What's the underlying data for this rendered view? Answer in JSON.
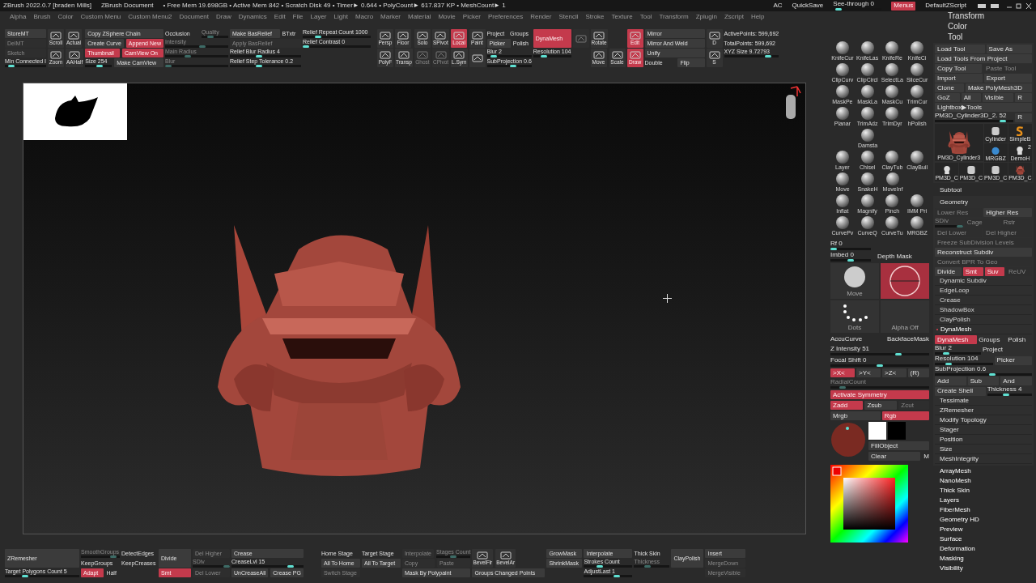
{
  "title_bar": {
    "title": "ZBrush 2022.0.7 [braden Mills]",
    "document": "ZBrush Document",
    "stats": "• Free Mem 19.698GB • Active Mem 842 • Scratch Disk 49 • Timer► 0.644 • PolyCount► 617.837 KP • MeshCount► 1",
    "right": [
      {
        "kind": "text",
        "label": "AC"
      },
      {
        "kind": "text",
        "label": "QuickSave"
      },
      {
        "kind": "slider",
        "label": "See-through  0",
        "level": 0.05,
        "disabled": false
      },
      {
        "kind": "btn",
        "label": "Menus",
        "on": true,
        "disabled": false
      },
      {
        "kind": "text",
        "label": "DefaultZScript"
      }
    ]
  },
  "menu_bar": [
    "Alpha",
    "Brush",
    "Color",
    "Custom Menu",
    "Custom Menu2",
    "Document",
    "Draw",
    "Dynamics",
    "Edit",
    "File",
    "Layer",
    "Light",
    "Macro",
    "Marker",
    "Material",
    "Movie",
    "Picker",
    "Preferences",
    "Render",
    "Stencil",
    "Stroke",
    "Texture",
    "Tool",
    "Transform",
    "Zplugin",
    "Zscript",
    "Help"
  ],
  "top_shelf": [
    [
      [
        {
          "kind": "btn",
          "label": "StoreMT",
          "on": false,
          "disabled": false
        }
      ],
      [
        {
          "kind": "btn",
          "label": "DelMT",
          "on": false,
          "disabled": true
        }
      ],
      [
        {
          "kind": "btn",
          "label": "Sketch",
          "on": false,
          "disabled": true
        }
      ],
      [
        {
          "kind": "slider",
          "label": "Min Connected I",
          "level": 0.1,
          "disabled": false
        }
      ]
    ],
    [
      [
        {
          "kind": "tile",
          "label": "Scroll",
          "on": false,
          "disabled": false
        }
      ],
      [
        {
          "kind": "tile",
          "label": "Zoom",
          "on": false,
          "disabled": false
        }
      ]
    ],
    [
      [
        {
          "kind": "tile",
          "label": "Actual",
          "on": false,
          "disabled": false
        }
      ],
      [
        {
          "kind": "tile",
          "label": "AAHalf",
          "on": false,
          "disabled": false
        }
      ]
    ],
    [
      [
        {
          "kind": "btn",
          "label": "Copy ZSphere Chain",
          "on": false,
          "disabled": false
        }
      ],
      [
        {
          "kind": "btn",
          "label": "Create Curve",
          "on": false,
          "disabled": false
        },
        {
          "kind": "btn",
          "label": "Append New",
          "on": true,
          "disabled": false
        }
      ],
      [
        {
          "kind": "btn",
          "label": "Thumbnail",
          "on": true,
          "disabled": false
        },
        {
          "kind": "btn",
          "label": "CamView On",
          "on": true,
          "disabled": false
        }
      ],
      [
        {
          "kind": "slider",
          "label": "Size 254",
          "level": 0.55,
          "disabled": false
        },
        {
          "kind": "btn",
          "label": "Make CamView",
          "on": false,
          "disabled": false
        }
      ]
    ],
    [
      [
        {
          "kind": "text",
          "label": "Occlusion"
        },
        {
          "kind": "slider",
          "label": "Quality",
          "level": 0.3,
          "disabled": true
        }
      ],
      [
        {
          "kind": "slider",
          "label": "Intensity",
          "level": 0.6,
          "disabled": true
        }
      ],
      [
        {
          "kind": "slider",
          "label": "Main Radius",
          "level": 0.35,
          "disabled": true
        }
      ],
      [
        {
          "kind": "slider",
          "label": "Blur",
          "level": 0.0,
          "disabled": true
        }
      ]
    ],
    [
      [
        {
          "kind": "btn",
          "label": "Make BasRelief",
          "on": false,
          "disabled": false
        },
        {
          "kind": "text",
          "label": "BTxtr"
        }
      ],
      [
        {
          "kind": "btn",
          "label": "Apply BasRelief",
          "on": false,
          "disabled": true
        }
      ],
      [
        {
          "kind": "slider",
          "label": "Relief Blur Radius 4",
          "level": 0.4,
          "disabled": false
        }
      ],
      [
        {
          "kind": "slider",
          "label": "Relief Step Tolerance 0.2",
          "level": 0.4,
          "disabled": false
        }
      ]
    ],
    [
      [
        {
          "kind": "slider",
          "label": "Relief Repeat Count 1000",
          "level": 0.2,
          "disabled": false
        }
      ],
      [
        {
          "kind": "slider",
          "label": "Relief Contrast 0",
          "level": 0.0,
          "disabled": false
        }
      ]
    ],
    [
      [
        {
          "kind": "tile",
          "label": "Persp",
          "on": false,
          "disabled": false
        }
      ],
      [
        {
          "kind": "tile",
          "label": "PolyF",
          "on": false,
          "disabled": false
        }
      ]
    ],
    [
      [
        {
          "kind": "tile",
          "label": "Floor",
          "on": false,
          "disabled": false
        }
      ],
      [
        {
          "kind": "tile",
          "label": "Transp",
          "on": false,
          "disabled": false
        }
      ]
    ],
    [
      [
        {
          "kind": "tile",
          "label": "Solo",
          "on": false,
          "disabled": false
        }
      ],
      [
        {
          "kind": "tile",
          "label": "Ghost",
          "on": false,
          "disabled": true
        }
      ]
    ],
    [
      [
        {
          "kind": "tile",
          "label": "SPivot",
          "on": false,
          "disabled": false
        }
      ],
      [
        {
          "kind": "tile",
          "label": "CPivot",
          "on": false,
          "disabled": true
        }
      ]
    ],
    [
      [
        {
          "kind": "tile",
          "label": "Local",
          "on": true,
          "disabled": false
        }
      ],
      [
        {
          "kind": "tile",
          "label": "L.Sym",
          "on": false,
          "disabled": false
        }
      ]
    ],
    [
      [
        {
          "kind": "tile",
          "label": "Paint",
          "on": false,
          "disabled": false
        }
      ],
      [
        {
          "kind": "tile",
          "on": false,
          "disabled": false
        }
      ]
    ],
    [
      [
        {
          "kind": "text",
          "label": "Project"
        },
        {
          "kind": "text",
          "label": "Groups"
        }
      ],
      [
        {
          "kind": "btn",
          "label": "Picker",
          "on": false,
          "disabled": false
        },
        {
          "kind": "text",
          "label": "Polish"
        }
      ],
      [
        {
          "kind": "slider",
          "label": "Blur 2",
          "level": 0.1,
          "disabled": false
        }
      ],
      [
        {
          "kind": "slider",
          "label": "SubProjection 0.6",
          "level": 0.6,
          "disabled": false
        }
      ]
    ],
    [
      [
        {
          "kind": "big",
          "label": "DynaMesh",
          "on": true,
          "disabled": false
        }
      ],
      [
        {
          "kind": "slider",
          "label": "Resolution 104",
          "level": 0.25,
          "disabled": false
        }
      ]
    ],
    [
      [
        {
          "kind": "tile",
          "on": false,
          "disabled": true
        }
      ]
    ],
    [
      [
        {
          "kind": "tile",
          "label": "Rotate",
          "on": false,
          "disabled": false
        }
      ],
      [
        {
          "kind": "tile",
          "label": "Move",
          "on": false,
          "disabled": false
        },
        {
          "kind": "tile",
          "label": "Scale",
          "on": false,
          "disabled": false
        }
      ]
    ],
    [
      [
        {
          "kind": "tile",
          "label": "Edit",
          "on": true,
          "disabled": false
        }
      ],
      [
        {
          "kind": "tile",
          "label": "Draw",
          "on": true,
          "disabled": false
        }
      ]
    ],
    [
      [
        {
          "kind": "btn",
          "label": "Mirror",
          "on": false,
          "disabled": false
        }
      ],
      [
        {
          "kind": "btn",
          "label": "Mirror And Weld",
          "on": false,
          "disabled": false
        }
      ],
      [
        {
          "kind": "btn",
          "label": "Unify",
          "on": false,
          "disabled": false
        }
      ],
      [
        {
          "kind": "text",
          "label": "Double"
        },
        {
          "kind": "btn",
          "label": "Flip",
          "on": false,
          "disabled": false
        }
      ]
    ],
    [
      [
        {
          "kind": "tile",
          "label": "D",
          "on": false,
          "disabled": false
        }
      ],
      [
        {
          "kind": "tile",
          "label": "S",
          "on": false,
          "disabled": false
        }
      ]
    ],
    [
      [
        {
          "kind": "text",
          "label": "ActivePoints: 599,692"
        }
      ],
      [
        {
          "kind": "text",
          "label": "TotalPoints: 599,692"
        }
      ],
      [
        {
          "kind": "slider",
          "label": "XYZ Size 9.72793",
          "level": 0.85,
          "disabled": false
        }
      ]
    ]
  ],
  "brush_palette": [
    [
      "KnifeCur",
      "KnifeLas",
      "KnifeRe",
      "KnifeCi"
    ],
    [
      "ClipCurv",
      "ClipCircl",
      "SelectLa",
      "SliceCur"
    ],
    [
      "MaskPe",
      "MaskLa",
      "MaskCu",
      "TrimCur"
    ],
    [
      "Planar",
      "TrimAdz",
      "TrimDyr",
      "hPolish"
    ],
    [
      "Damsta"
    ],
    [
      "Layer",
      "Chisel",
      "ClayTub",
      "ClayBuil"
    ],
    [
      "Move",
      "SnakeH",
      "MoveInf"
    ],
    [
      "Inflat",
      "Magnify",
      "Pinch",
      "IMM Pri"
    ],
    [
      "CurvePv",
      "CurveQ",
      "CurveTu",
      "MRGBZ"
    ]
  ],
  "brush_controls": {
    "rf": {
      "label": "Rf 0",
      "level": 0.0
    },
    "imbed": {
      "label": "Imbed 0",
      "level": 0.5
    },
    "depth_mask_label": "Depth Mask",
    "brush_tile": "Move",
    "depth_tile": {
      "on": true
    },
    "stroke_tile": "Dots",
    "alpha_tile": "Alpha Off",
    "accucurve": "AccuCurve",
    "backface": "BackfaceMask",
    "z_intensity": {
      "label": "Z Intensity 51",
      "level": 0.7
    },
    "focal_shift": {
      "label": "Focal Shift 0",
      "level": 0.5
    },
    "symmetry": [
      {
        "label": ">X<",
        "on": true,
        "disabled": false
      },
      {
        "label": ">Y<",
        "on": false,
        "disabled": false
      },
      {
        "label": ">Z<",
        "on": false,
        "disabled": false
      },
      {
        "label": "(R)",
        "on": false,
        "disabled": false
      }
    ],
    "radial": {
      "label": "RadialCount",
      "level": 0.1,
      "disabled": true
    },
    "activate_symmetry": {
      "label": "Activate Symmetry",
      "on": true,
      "disabled": false
    },
    "modes": [
      {
        "label": "Zadd",
        "on": true,
        "disabled": false
      },
      {
        "label": "Zsub",
        "on": false,
        "disabled": false
      },
      {
        "label": "Zcut",
        "on": false,
        "disabled": true
      }
    ],
    "color_modes": [
      {
        "label": "Mrgb",
        "on": false,
        "disabled": false
      },
      {
        "label": "Rgb",
        "on": true,
        "disabled": false
      }
    ],
    "fill": "FillObject",
    "clear": "Clear",
    "m": "M"
  },
  "tool_panel": {
    "headers": [
      "Transform",
      "Color",
      "Tool"
    ],
    "rows": [
      [
        {
          "kind": "btn",
          "label": "Load Tool",
          "on": false,
          "disabled": false
        },
        {
          "kind": "btn",
          "label": "Save As",
          "on": false,
          "disabled": false
        }
      ],
      [
        {
          "kind": "btn",
          "label": "Load Tools From Project",
          "on": false,
          "disabled": false
        }
      ],
      [
        {
          "kind": "btn",
          "label": "Copy Tool",
          "on": false,
          "disabled": false
        },
        {
          "kind": "btn",
          "label": "Paste Tool",
          "on": false,
          "disabled": true
        }
      ],
      [
        {
          "kind": "btn",
          "label": "Import",
          "on": false,
          "disabled": false
        },
        {
          "kind": "btn",
          "label": "Export",
          "on": false,
          "disabled": false
        }
      ],
      [
        {
          "kind": "btn",
          "label": "Clone",
          "on": false,
          "disabled": false
        },
        {
          "kind": "btn",
          "label": "Make PolyMesh3D",
          "on": false,
          "disabled": false
        }
      ],
      [
        {
          "kind": "btn",
          "label": "GoZ",
          "on": false,
          "disabled": false
        },
        {
          "kind": "btn",
          "label": "All",
          "on": false,
          "disabled": false
        },
        {
          "kind": "btn",
          "label": "Visible",
          "on": false,
          "disabled": false
        },
        {
          "kind": "btn",
          "label": "R",
          "on": false,
          "disabled": false
        }
      ],
      [
        {
          "kind": "btn",
          "label": "Lightbox▶Tools",
          "on": false,
          "disabled": false
        }
      ],
      [
        {
          "kind": "slider",
          "label": "PM3D_Cylinder3D_2. 52",
          "level": 0.9,
          "disabled": false
        },
        {
          "kind": "btn",
          "label": "R",
          "on": false,
          "disabled": false
        }
      ]
    ],
    "thumbnails": [
      {
        "label": "PM3D_Cylinder3",
        "kind": "helmet"
      },
      {
        "label": "Cylinder",
        "kind": "cylinder"
      },
      {
        "label": "SimpleB",
        "kind": "brush"
      },
      {
        "label": "MRGBZ",
        "kind": "sphere"
      },
      {
        "label": "DemoH",
        "kind": "head",
        "badge": "2"
      },
      {
        "label": "PM3D_C",
        "kind": "head"
      },
      {
        "label": "PM3D_C",
        "kind": "cylinder"
      },
      {
        "label": "PM3D_C",
        "kind": "cylinder"
      },
      {
        "label": "PM3D_C",
        "kind": "helmet"
      }
    ],
    "subtool": "Subtool",
    "geometry": "Geometry",
    "geometry_rows": [
      [
        {
          "kind": "btn",
          "label": "Lower Res",
          "on": false,
          "disabled": true
        },
        {
          "kind": "btn",
          "label": "Higher Res",
          "on": false,
          "disabled": false
        }
      ],
      [
        {
          "kind": "slider",
          "label": "SDiv",
          "level": 1,
          "disabled": true
        },
        {
          "kind": "btn",
          "label": "Cage",
          "on": false,
          "disabled": true
        },
        {
          "kind": "btn",
          "label": "Rstr",
          "on": false,
          "disabled": true
        }
      ],
      [
        {
          "kind": "btn",
          "label": "Del Lower",
          "on": false,
          "disabled": true
        },
        {
          "kind": "btn",
          "label": "Del Higher",
          "on": false,
          "disabled": true
        }
      ],
      [
        {
          "kind": "btn",
          "label": "Freeze SubDivision Levels",
          "on": false,
          "disabled": true
        }
      ],
      [
        {
          "kind": "btn",
          "label": "Reconstruct Subdiv",
          "on": false,
          "disabled": false
        }
      ],
      [
        {
          "kind": "btn",
          "label": "Convert BPR To Geo",
          "on": false,
          "disabled": true
        }
      ],
      [
        {
          "kind": "btn",
          "label": "Divide",
          "on": false,
          "disabled": false
        },
        {
          "kind": "btn",
          "label": "Smt",
          "on": true,
          "disabled": false
        },
        {
          "kind": "btn",
          "label": "Suv",
          "on": true,
          "disabled": false
        },
        {
          "kind": "btn",
          "label": "ReUV",
          "on": false,
          "disabled": true
        }
      ]
    ],
    "sections": [
      {
        "label": "Dynamic Subdiv",
        "expanded": false
      },
      {
        "label": "EdgeLoop",
        "expanded": false
      },
      {
        "label": "Crease",
        "expanded": false
      },
      {
        "label": "ShadowBox",
        "expanded": false
      },
      {
        "label": "ClayPolish",
        "expanded": false
      },
      {
        "label": "DynaMesh",
        "expanded": true
      }
    ],
    "dynamesh_rows": [
      [
        {
          "kind": "btn",
          "label": "DynaMesh",
          "on": true,
          "disabled": false
        },
        {
          "kind": "text",
          "label": "Groups"
        },
        {
          "kind": "text",
          "label": "Polish"
        }
      ],
      [
        {
          "kind": "slider",
          "label": "Blur 2",
          "level": 0.2,
          "disabled": false
        },
        {
          "kind": "text",
          "label": "Project"
        }
      ],
      [
        {
          "kind": "slider",
          "label": "Resolution 104",
          "level": 0.2,
          "disabled": false
        },
        {
          "kind": "btn",
          "label": "Picker",
          "on": false,
          "disabled": false
        }
      ],
      [
        {
          "kind": "slider",
          "label": "SubProjection 0.6",
          "level": 0.6,
          "disabled": false
        }
      ],
      [
        {
          "kind": "btn",
          "label": "Add",
          "on": false,
          "disabled": false
        },
        {
          "kind": "btn",
          "label": "Sub",
          "on": false,
          "disabled": false
        },
        {
          "kind": "btn",
          "label": "And",
          "on": false,
          "disabled": false
        }
      ],
      [
        {
          "kind": "btn",
          "label": "Create Shell",
          "on": false,
          "disabled": false
        },
        {
          "kind": "slider",
          "label": "Thickness 4",
          "level": 0.4,
          "disabled": false
        }
      ]
    ],
    "sub_sections": [
      "Tessimate",
      "ZRemesher",
      "Modify Topology",
      "Stager",
      "Position",
      "Size",
      "MeshIntegrity"
    ],
    "menus": [
      "ArrayMesh",
      "NanoMesh",
      "Thick Skin",
      "Layers",
      "FiberMesh",
      "Geometry HD",
      "Preview",
      "Surface",
      "Deformation",
      "Masking",
      "Visibility"
    ]
  },
  "bottom_shelf": [
    [
      [
        {
          "kind": "big",
          "label": "ZRemesher",
          "on": false,
          "disabled": false
        }
      ],
      [
        {
          "kind": "slider",
          "label": "Target Polygons Count 5",
          "level": 0.25,
          "disabled": false
        }
      ]
    ],
    [
      [
        {
          "kind": "slider",
          "label": "SmoothGroups",
          "level": 0.9,
          "disabled": true
        }
      ],
      [
        {
          "kind": "text",
          "label": "KeepGroups"
        }
      ],
      [
        {
          "kind": "btn",
          "label": "Adapt",
          "on": true,
          "disabled": false
        },
        {
          "kind": "text",
          "label": "Half"
        }
      ]
    ],
    [
      [
        {
          "kind": "text",
          "label": "DetectEdges"
        }
      ],
      [
        {
          "kind": "text",
          "label": "KeepCreases"
        }
      ]
    ],
    [
      [
        {
          "kind": "big",
          "label": "Divide",
          "on": false,
          "disabled": false
        }
      ],
      [
        {
          "kind": "btn",
          "label": "Smt",
          "on": true,
          "disabled": false
        }
      ]
    ],
    [
      [
        {
          "kind": "btn",
          "label": "Del Higher",
          "on": false,
          "disabled": true
        }
      ],
      [
        {
          "kind": "slider",
          "label": "SDiv",
          "level": 1,
          "disabled": true
        }
      ],
      [
        {
          "kind": "btn",
          "label": "Del Lower",
          "on": false,
          "disabled": true
        }
      ]
    ],
    [
      [
        {
          "kind": "btn",
          "label": "Crease",
          "on": false,
          "disabled": false
        }
      ],
      [
        {
          "kind": "slider",
          "label": "CreaseLvl 15",
          "level": 0.85,
          "disabled": false
        }
      ],
      [
        {
          "kind": "btn",
          "label": "UnCreaseAll",
          "on": false,
          "disabled": false
        },
        {
          "kind": "btn",
          "label": "Crease PG",
          "on": false,
          "disabled": false
        }
      ]
    ],
    [
      [
        {
          "kind": "text",
          "label": "Home Stage"
        }
      ],
      [
        {
          "kind": "btn",
          "label": "All To Home",
          "on": false,
          "disabled": false
        }
      ],
      [
        {
          "kind": "btn",
          "label": "Switch Stage",
          "on": false,
          "disabled": true
        }
      ]
    ],
    [
      [
        {
          "kind": "text",
          "label": "Target Stage"
        }
      ],
      [
        {
          "kind": "btn",
          "label": "All To Target",
          "on": false,
          "disabled": false
        }
      ]
    ],
    [
      [
        {
          "kind": "btn",
          "label": "Interpolate",
          "on": false,
          "disabled": true
        },
        {
          "kind": "slider",
          "label": "Stages Count",
          "level": 0.5,
          "disabled": true
        }
      ],
      [
        {
          "kind": "btn",
          "label": "Copy",
          "on": false,
          "disabled": true
        },
        {
          "kind": "btn",
          "label": "Paste",
          "on": false,
          "disabled": true
        }
      ],
      [
        {
          "kind": "btn",
          "label": "Mask By Polypaint",
          "on": false,
          "disabled": false
        }
      ]
    ],
    [
      [
        {
          "kind": "tile",
          "label": "BevelFlr",
          "on": false,
          "disabled": false
        },
        {
          "kind": "tile",
          "label": "BevelAr",
          "on": false,
          "disabled": false
        }
      ],
      [
        {
          "kind": "btn",
          "label": "Groups Changed Points",
          "on": false,
          "disabled": false
        }
      ]
    ],
    [
      [
        {
          "kind": "btn",
          "label": "GrowMask",
          "on": false,
          "disabled": false
        }
      ],
      [
        {
          "kind": "btn",
          "label": "ShrinkMask",
          "on": false,
          "disabled": false
        }
      ]
    ],
    [
      [
        {
          "kind": "btn",
          "label": "Interpolate",
          "on": false,
          "disabled": false
        }
      ],
      [
        {
          "kind": "slider",
          "label": "Strokes Count",
          "level": 0.3,
          "disabled": false
        }
      ],
      [
        {
          "kind": "slider",
          "label": "AdjustLast 1",
          "level": 0.7,
          "disabled": false
        }
      ]
    ],
    [
      [
        {
          "kind": "text",
          "label": "Thick Skin"
        }
      ],
      [
        {
          "kind": "slider",
          "label": "Thickness",
          "level": 0.35,
          "disabled": true
        }
      ]
    ],
    [
      [
        {
          "kind": "big",
          "label": "ClayPolish",
          "on": false,
          "disabled": false
        }
      ]
    ],
    [
      [
        {
          "kind": "btn",
          "label": "Insert",
          "on": false,
          "disabled": false
        }
      ],
      [
        {
          "kind": "btn",
          "label": "MergeDown",
          "on": false,
          "disabled": true
        }
      ],
      [
        {
          "kind": "btn",
          "label": "MergeVisible",
          "on": false,
          "disabled": true
        }
      ]
    ]
  ]
}
